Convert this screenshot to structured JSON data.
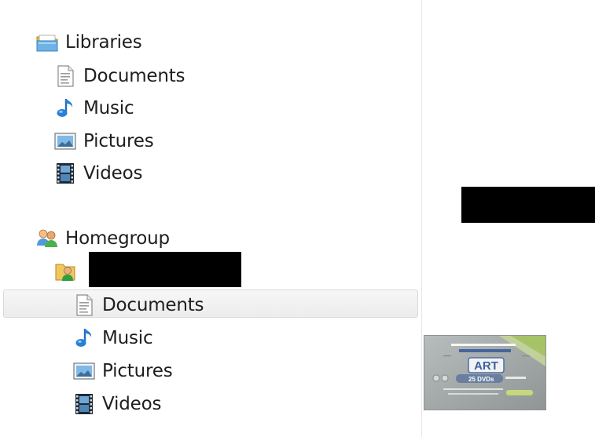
{
  "navigation": {
    "libraries": {
      "label": "Libraries",
      "items": [
        {
          "label": "Documents",
          "icon": "documents-icon"
        },
        {
          "label": "Music",
          "icon": "music-icon"
        },
        {
          "label": "Pictures",
          "icon": "pictures-icon"
        },
        {
          "label": "Videos",
          "icon": "videos-icon"
        }
      ]
    },
    "homegroup": {
      "label": "Homegroup",
      "user": {
        "label": "",
        "items": [
          {
            "label": "Documents",
            "icon": "documents-icon",
            "selected": true
          },
          {
            "label": "Music",
            "icon": "music-icon"
          },
          {
            "label": "Pictures",
            "icon": "pictures-icon"
          },
          {
            "label": "Videos",
            "icon": "videos-icon"
          }
        ]
      }
    }
  },
  "content": {
    "thumbnail": {
      "name": "ART 25 DVDs",
      "title_text": "ART",
      "subtitle_text": "25 DVDs"
    }
  },
  "colors": {
    "selection_background": "#ececec",
    "folder_yellow": "#f0c75e",
    "music_blue": "#2a7fd6"
  }
}
